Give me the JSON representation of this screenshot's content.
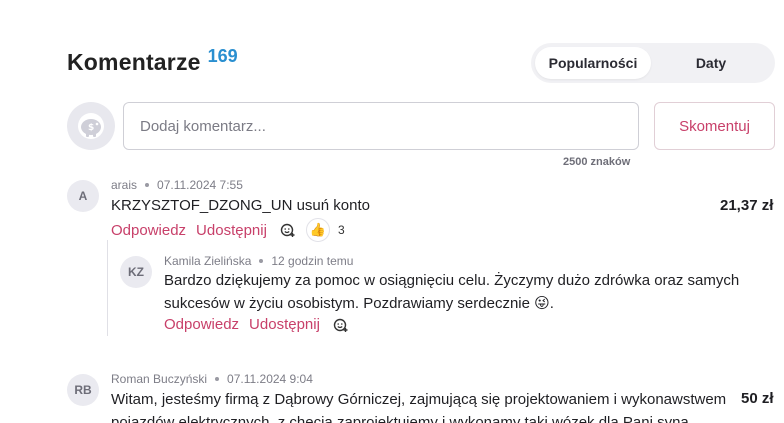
{
  "header": {
    "title": "Komentarze",
    "count": "169"
  },
  "sort": {
    "popular_label": "Popularności",
    "date_label": "Daty"
  },
  "composer": {
    "placeholder": "Dodaj komentarz...",
    "submit_label": "Skomentuj",
    "char_limit": "2500 znaków"
  },
  "comments": [
    {
      "initials": "A",
      "author": "arais",
      "date": "07.11.2024 7:55",
      "text": "KRZYSZTOF_DZONG_UN usuń konto",
      "amount": "21,37 zł",
      "reply_label": "Odpowiedz",
      "share_label": "Udostępnij",
      "reaction_emoji": "👍",
      "reaction_count": "3"
    },
    {
      "initials": "KZ",
      "author": "Kamila Zielińska",
      "date": "12 godzin temu",
      "text_line1": "Bardzo dziękujemy za pomoc w osiągnięciu celu. Życzymy dużo zdrówka oraz samych",
      "text_line2": "sukcesów w życiu osobistym. Pozdrawiamy serdecznie",
      "emoji": "😜",
      "reply_label": "Odpowiedz",
      "share_label": "Udostępnij"
    },
    {
      "initials": "RB",
      "author": "Roman Buczyński",
      "date": "07.11.2024 9:04",
      "text_line1": "Witam, jesteśmy firmą z Dąbrowy Górniczej, zajmującą się projektowaniem i wykonawstwem",
      "text_line2": "pojazdów elektrycznych, z chęcią zaprojektujemy i wykonamy taki wózek dla Pani syna",
      "amount": "50 zł"
    }
  ]
}
